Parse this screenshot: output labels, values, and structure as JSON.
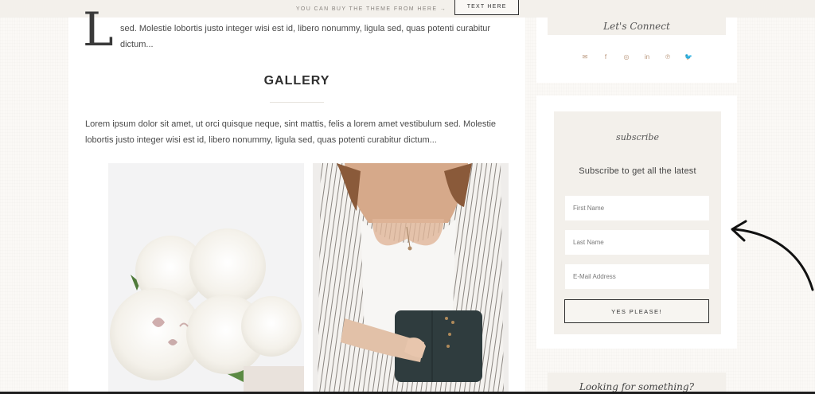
{
  "topbar": {
    "promo_text": "YOU CAN BUY THE THEME FROM HERE →",
    "button_label": "TEXT HERE"
  },
  "article": {
    "dropcap": "L",
    "intro_text": "sed. Molestie lobortis justo integer wisi est id, libero nonummy, ligula sed, quas potenti curabitur dictum...",
    "gallery_title": "GALLERY",
    "gallery_text": "Lorem ipsum dolor sit amet, ut orci quisque neque, sint mattis, felis a lorem amet vestibulum sed. Molestie lobortis justo integer wisi est id, libero nonummy, ligula sed, quas potenti curabitur dictum..."
  },
  "sidebar": {
    "connect_title": "Let's Connect",
    "social_icons": [
      "email-icon",
      "facebook-icon",
      "instagram-icon",
      "linkedin-icon",
      "pinterest-icon",
      "twitter-icon"
    ],
    "social_glyphs": [
      "✉",
      "f",
      "◎",
      "in",
      "℗",
      "🐦"
    ],
    "subscribe_script": "subscribe",
    "subscribe_tagline": "Subscribe to get all the latest",
    "first_name_placeholder": "First Name",
    "last_name_placeholder": "Last Name",
    "email_placeholder": "E-Mail Address",
    "submit_label": "YES PLEASE!",
    "bottom_heading": "Looking for something?"
  },
  "colors": {
    "accent": "#b9967b",
    "background": "#fbf9f6",
    "panel": "#f3f0eb"
  }
}
